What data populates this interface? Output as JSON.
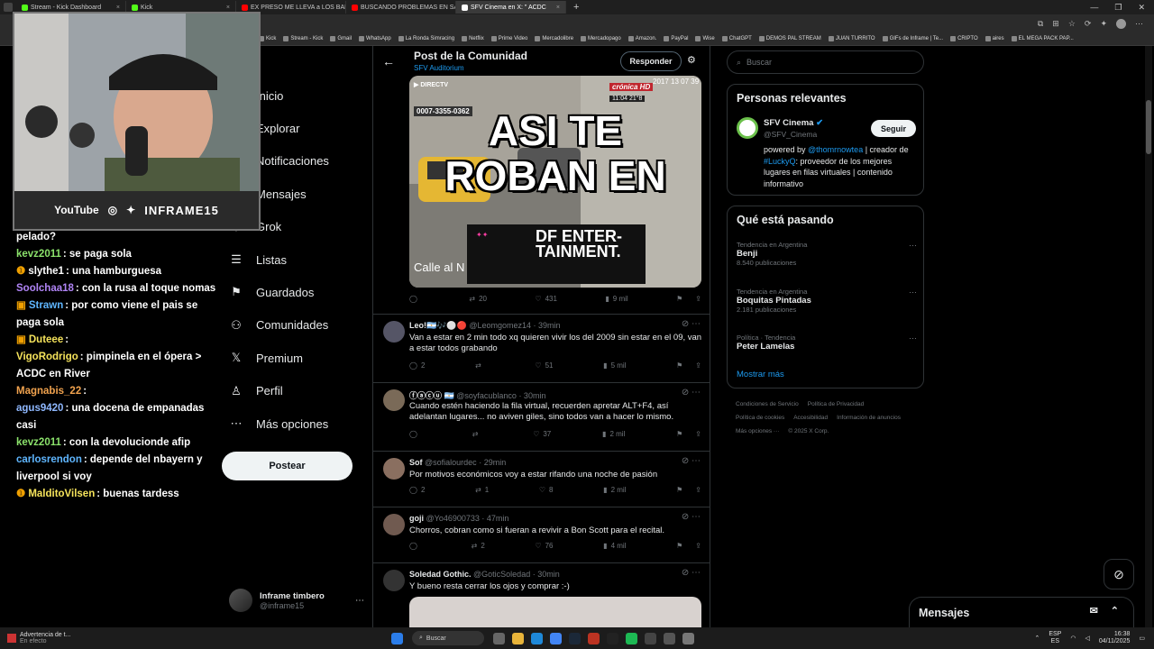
{
  "browser": {
    "tabs": [
      {
        "label": "Stream - Kick Dashboard",
        "color": "#53fc18",
        "active": false
      },
      {
        "label": "Kick",
        "color": "#53fc18",
        "active": false
      },
      {
        "label": "EX PRESO ME LLEVA a LOS BARR",
        "color": "#ff0000",
        "active": false
      },
      {
        "label": "BUSCANDO PROBLEMAS EN SAN",
        "color": "#ff0000",
        "active": false
      },
      {
        "label": "SFV Cinema en X: \" ACDC",
        "color": "#ffffff",
        "active": true
      }
    ],
    "newtab": "+",
    "bookmarks": [
      "Kick",
      "Stream - Kick",
      "Gmail",
      "WhatsApp",
      "La Ronda Simracing",
      "Netflix",
      "Prime Video",
      "Mercadolibre",
      "Mercadopago",
      "Amazon.",
      "PayPal",
      "Wise",
      "ChatGPT",
      "DEMOS PAL STREAM",
      "JUAN TURRITO",
      "GIFs de Inframe | Te...",
      "CRIPTO",
      "aires",
      "EL MEGA PACK PAP..."
    ]
  },
  "stream": {
    "social_bar": "YouTube",
    "brand": "INFRAME15",
    "chat": [
      {
        "user": "",
        "msg": "pelado?",
        "color": "#ffffff",
        "badge": ""
      },
      {
        "user": "kevz2011",
        "msg": ": se paga sola",
        "color": "#8be26b",
        "badge": ""
      },
      {
        "user": "slythe1",
        "msg": ": una hamburguesa",
        "color": "#ffffff",
        "badge": "❶"
      },
      {
        "user": "Soolchaa18",
        "msg": ": con la rusa al toque nomas",
        "color": "#b084f5",
        "badge": ""
      },
      {
        "user": "Strawn",
        "msg": ": por como viene el pais se paga sola",
        "color": "#5fb6ff",
        "badge": "▣"
      },
      {
        "user": "Duteee",
        "msg": ":",
        "color": "#f5e35b",
        "badge": "▣"
      },
      {
        "user": "VigoRodrigo",
        "msg": ": pimpinela en el ópera > ACDC en River",
        "color": "#f5e35b",
        "badge": ""
      },
      {
        "user": "Magnabis_22",
        "msg": ":",
        "color": "#f0a24e",
        "badge": ""
      },
      {
        "user": "agus9420",
        "msg": ": una docena de empanadas casi",
        "color": "#8fb8ff",
        "badge": ""
      },
      {
        "user": "kevz2011",
        "msg": ": con la devolucionde afip",
        "color": "#8be26b",
        "badge": ""
      },
      {
        "user": "carlosrendon",
        "msg": ": depende del nbayern y liverpool si voy",
        "color": "#5fb6ff",
        "badge": ""
      },
      {
        "user": "MalditoVilsen",
        "msg": ": buenas tardess",
        "color": "#f5e35b",
        "badge": "❶"
      }
    ]
  },
  "nav": {
    "items": [
      {
        "label": "Inicio",
        "icon": "home-icon",
        "glyph": "⌂"
      },
      {
        "label": "Explorar",
        "icon": "search-icon",
        "glyph": "⌕"
      },
      {
        "label": "Notificaciones",
        "icon": "bell-icon",
        "glyph": "◔"
      },
      {
        "label": "Mensajes",
        "icon": "mail-icon",
        "glyph": "✉"
      },
      {
        "label": "Grok",
        "icon": "grok-icon",
        "glyph": "⊘"
      },
      {
        "label": "Listas",
        "icon": "list-icon",
        "glyph": "☰"
      },
      {
        "label": "Guardados",
        "icon": "bookmark-icon",
        "glyph": "⚑"
      },
      {
        "label": "Comunidades",
        "icon": "people-icon",
        "glyph": "⚇"
      },
      {
        "label": "Premium",
        "icon": "x-logo-icon",
        "glyph": "𝕏"
      },
      {
        "label": "Perfil",
        "icon": "person-icon",
        "glyph": "♙"
      },
      {
        "label": "Más opciones",
        "icon": "more-circle-icon",
        "glyph": "⋯"
      }
    ],
    "post_button": "Postear",
    "user_name": "Inframe timbero",
    "user_handle": "@inframe15"
  },
  "post": {
    "title": "Post de la Comunidad",
    "community": "SFV Auditorium",
    "respond": "Responder",
    "media_text": [
      "ASI TE",
      "ROBAN EN"
    ],
    "media_logo": "DF ENTER- TAINMENT.",
    "media_phone": "0007-3355-0362",
    "media_channel": "crónica HD",
    "media_time": "11:04   21°8",
    "media_date": "2017 13 07 39",
    "media_sign": "Calle al N",
    "stats": {
      "reply": "",
      "retweet": "20",
      "like": "431",
      "views": "9 mil"
    },
    "replies": [
      {
        "name": "Leo!🇦🇷🎶⚪🔴",
        "handle": "@Leomgomez14",
        "time": "· 39min",
        "text": "Van a estar en 2 min todo xq quieren vivir los del 2009  sin estar en el 09, van a estar todos grabando",
        "stats": [
          "2",
          "",
          "51",
          "5 mil"
        ],
        "av": "#556"
      },
      {
        "name": "ⓕⓐⓒⓤ 🇦🇷",
        "handle": "@soyfacublanco",
        "time": "· 30min",
        "text": "Cuando estén haciendo la fila virtual, recuerden apretar ALT+F4, así adelantan lugares... no aviven giles, sino todos van a hacer lo mismo.",
        "stats": [
          "",
          "",
          "37",
          "2 mil"
        ],
        "av": "#7a6a58"
      },
      {
        "name": "Sof",
        "handle": "@sofialourdec",
        "time": "· 29min",
        "text": "Por motivos económicos voy a estar rifando una noche de pasión",
        "stats": [
          "2",
          "1",
          "8",
          "2 mil"
        ],
        "av": "#8a6f60"
      },
      {
        "name": "goji",
        "handle": "@Yo46900733",
        "time": "· 47min",
        "text": "Chorros, cobran como si fueran a revivir a Bon Scott para el recital.",
        "stats": [
          "",
          "2",
          "76",
          "4 mil"
        ],
        "av": "#705a50"
      },
      {
        "name": "Soledad Gothic.",
        "handle": "@GoticSoledad",
        "time": "· 30min",
        "text": "Y bueno resta cerrar los ojos y comprar :-)",
        "stats": [],
        "av": "#333"
      }
    ]
  },
  "sidebar": {
    "search_placeholder": "Buscar",
    "relevant_title": "Personas relevantes",
    "person_name": "SFV Cinema",
    "person_handle": "@SFV_Cinema",
    "follow": "Seguir",
    "bio_parts": [
      "powered by ",
      "@thomrnowtea",
      " | creador de ",
      "#LuckyQ",
      ": proveedor de los mejores lugares en filas virtuales | contenido informativo"
    ],
    "trending_title": "Qué está pasando",
    "trends": [
      {
        "cat": "Tendencia en Argentina",
        "name": "Benji",
        "count": "8.540 publicaciones"
      },
      {
        "cat": "Tendencia en Argentina",
        "name": "Boquitas Pintadas",
        "count": "2.181 publicaciones"
      },
      {
        "cat": "Política · Tendencia",
        "name": "Peter Lamelas",
        "count": ""
      }
    ],
    "show_more": "Mostrar más",
    "footer": [
      "Condiciones de Servicio",
      "Política de Privacidad",
      "Política de cookies",
      "Accesibilidad",
      "Información de anuncios",
      "Más opciones ···",
      "© 2025 X Corp."
    ],
    "messages": "Mensajes"
  },
  "taskbar": {
    "notif_title": "Advertencia de t...",
    "notif_sub": "En efecto",
    "search": "Buscar",
    "lang": "ESP",
    "lang2": "ES",
    "time": "16:38",
    "date": "04/11/2025"
  }
}
